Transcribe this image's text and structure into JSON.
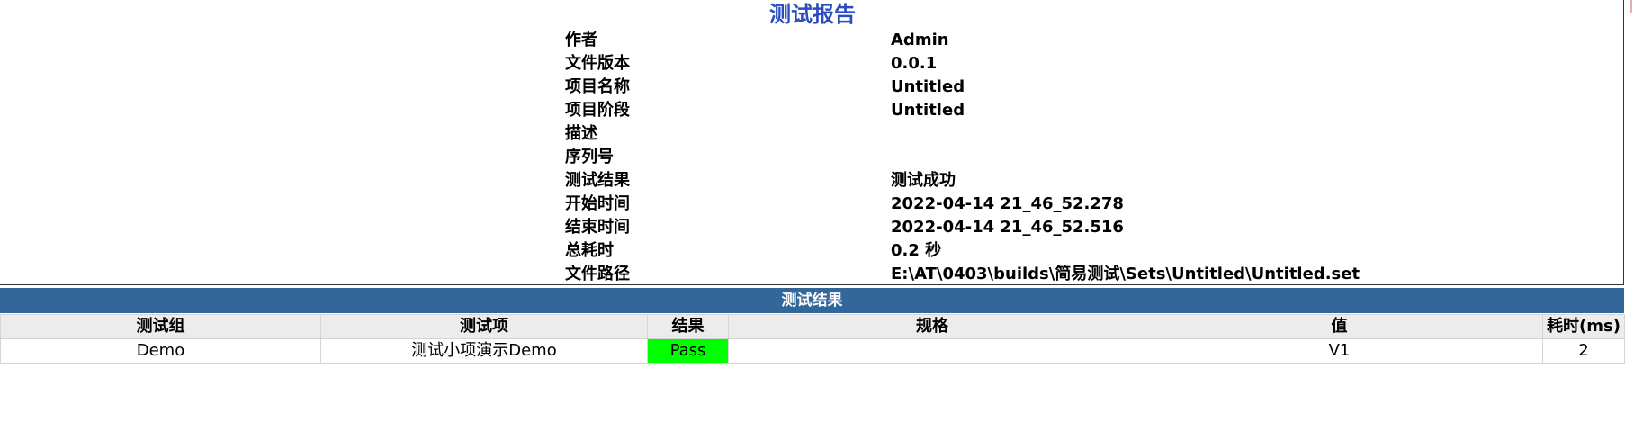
{
  "report": {
    "title": "测试报告",
    "meta": [
      {
        "label": "作者",
        "value": "Admin"
      },
      {
        "label": "文件版本",
        "value": "0.0.1"
      },
      {
        "label": "项目名称",
        "value": "Untitled"
      },
      {
        "label": "项目阶段",
        "value": "Untitled"
      },
      {
        "label": "描述",
        "value": ""
      },
      {
        "label": "序列号",
        "value": ""
      },
      {
        "label": "测试结果",
        "value": "测试成功"
      },
      {
        "label": "开始时间",
        "value": "2022-04-14 21_46_52.278"
      },
      {
        "label": "结束时间",
        "value": "2022-04-14 21_46_52.516"
      },
      {
        "label": "总耗时",
        "value": "0.2 秒"
      },
      {
        "label": "文件路径",
        "value": "E:\\AT\\0403\\builds\\简易测试\\Sets\\Untitled\\Untitled.set"
      }
    ]
  },
  "results": {
    "title": "测试结果",
    "columns": [
      "测试组",
      "测试项",
      "结果",
      "规格",
      "值",
      "耗时(ms)"
    ],
    "rows": [
      [
        "Demo",
        "测试小项演示Demo",
        "Pass",
        "",
        "V1",
        "2"
      ]
    ],
    "colors": {
      "header_bg": "#336699",
      "pass_bg": "#00ff00",
      "title_color": "#2a4ec2"
    }
  }
}
